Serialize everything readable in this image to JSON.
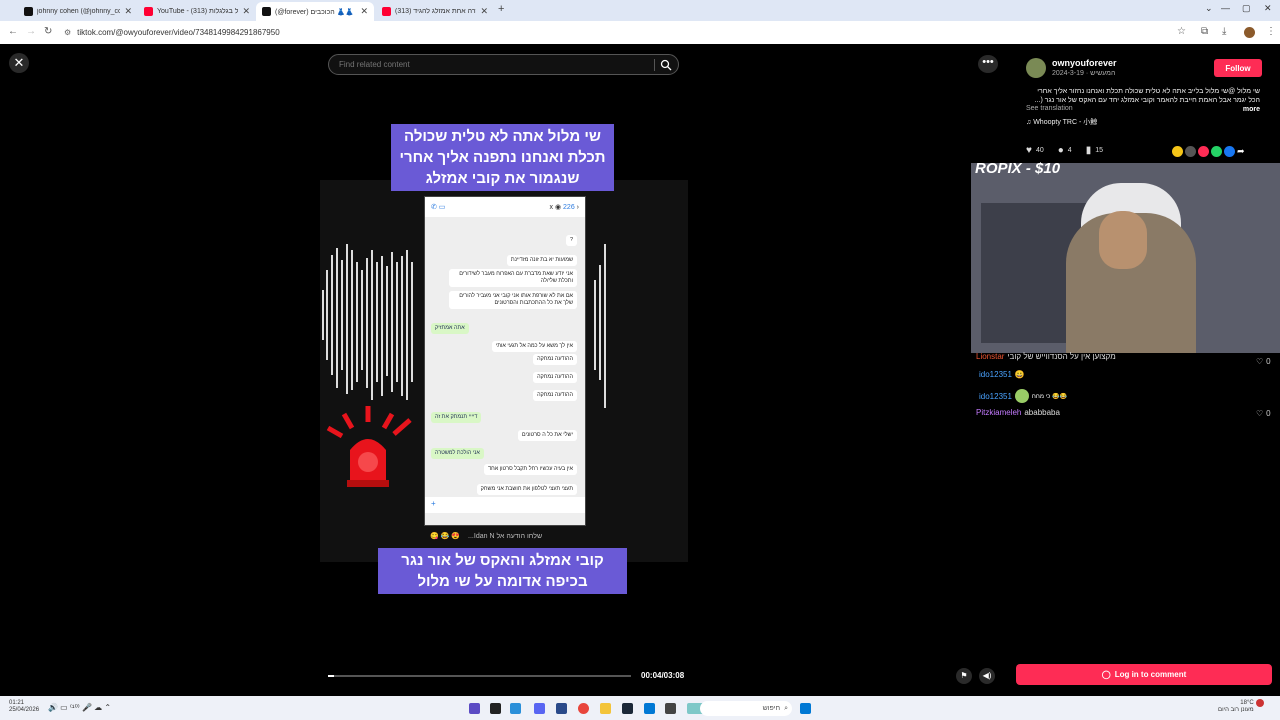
{
  "browser": {
    "tabs": [
      {
        "title": "johnny cohen (@johnny_cohen...",
        "favicon_color": "#111111",
        "active": false
      },
      {
        "title": "YouTube - (313) יוסי של בגלגלות",
        "favicon_color": "#ff0033",
        "active": false
      },
      {
        "title": "(@forever) הכוכבים 👗👗",
        "favicon_color": "#111111",
        "active": true
      },
      {
        "title": "(313) סדרה אחת אמזלג להגיד",
        "favicon_color": "#ff0033",
        "active": false
      }
    ],
    "url": "tiktok.com/@owyouforever/video/7348149984291867950"
  },
  "video": {
    "search_placeholder": "Find related content",
    "caption_top": [
      "שי מלול אתה לא טלית שכולה",
      "תכלת ואנחנו נתפנה אליך אחרי",
      "שנגמור את קובי אמזלג"
    ],
    "caption_bottom": [
      "קובי אמזלג והאקס של אור נגר",
      "בכיפה אדומה על שי מלול"
    ],
    "phone": {
      "contact_count": "226",
      "messages": [
        {
          "text": "?",
          "side": "in"
        },
        {
          "text": "שמועות יא בת זונה מזדיינת",
          "side": "in"
        },
        {
          "text": "אני יודע שאת מדברת עם האפרוח מעבר לשידורים ותכלת שלי/לה",
          "side": "in"
        },
        {
          "text": "אם את לא שורפת אותו אני קובי אני מעביר להורים שלך את כל ההתכתבות והסרטונים",
          "side": "in"
        },
        {
          "text": "אתה אמתזיק",
          "side": "out"
        },
        {
          "text": "אין לך משא על כמה אל תגעי אותי",
          "side": "in"
        },
        {
          "text": "ההודעה נמחקה",
          "side": "in"
        },
        {
          "text": "ההודעה נמחקה",
          "side": "in"
        },
        {
          "text": "ההודעה נמחקה",
          "side": "in"
        },
        {
          "text": "דיייי תנמתק את זה",
          "side": "out"
        },
        {
          "text": "ישלי את כל ה סרטונים",
          "side": "in"
        },
        {
          "text": "אני הולכת למשטרה",
          "side": "out"
        },
        {
          "text": "אין בעיה עכשיו רחל תקבל סרטון אחד",
          "side": "in"
        },
        {
          "text": "תעצי תעצי לטלפון את חושבת אני משחק",
          "side": "in"
        }
      ],
      "input_placeholder": "שלחו הודעה אל Idan N..."
    },
    "progress": 0.02,
    "time": "00:04/03:08"
  },
  "panel": {
    "author": "ownyouforever",
    "author_sub": "המעשיש · 2024-3-19",
    "follow_label": "Follow",
    "description": "שי מלול @שי מלול בלייב אתה לא טלית שכולה תכלת ואנחנו נחזור אליך אחרי הכל יגמר אבל האמת חייבת להאמר וקובי אמזלג יחד עם האקס של אור נגר (...",
    "more_label": "more",
    "see_translation": "See translation",
    "music": "Whoopty TRC - 小鯨",
    "likes": "40",
    "comments": "4",
    "saves": "15",
    "share_colors": [
      "#f5c518",
      "#555555",
      "#fe2c55",
      "#25d366",
      "#1877f2"
    ],
    "login_label": "Log in to comment"
  },
  "stream": {
    "donation": "ROPIX - $10",
    "chat": [
      {
        "name": "Lionstar",
        "text": "מקצוען אין על הסנדווייש של קובי",
        "likes": "0"
      },
      {
        "name": "ido12351",
        "text": "😀",
        "likes": ""
      },
      {
        "name": "ido12351",
        "text": "כי מחח 😂😂",
        "likes": ""
      },
      {
        "name": "Pitzkiameleh",
        "text": "ababbaba",
        "likes": "0"
      }
    ]
  },
  "taskbar": {
    "time": "01:21",
    "date": "25/04/2026",
    "search_placeholder": "חיפוש",
    "weather": "18°C",
    "weather_sub": "מעונן רוב היום"
  }
}
